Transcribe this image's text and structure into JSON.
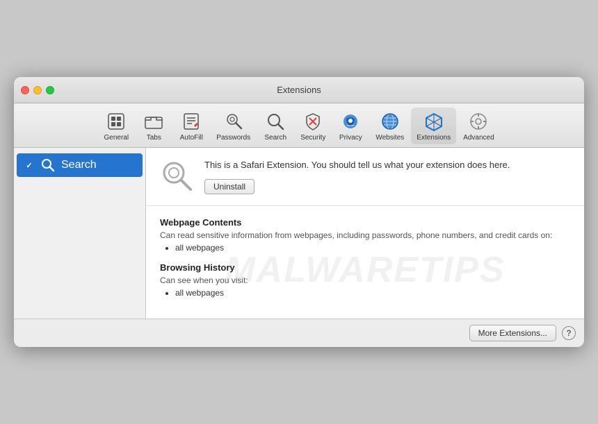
{
  "window": {
    "title": "Extensions"
  },
  "titlebar": {
    "buttons": {
      "close": "close",
      "minimize": "minimize",
      "maximize": "maximize"
    }
  },
  "toolbar": {
    "items": [
      {
        "id": "general",
        "label": "General",
        "icon": "general"
      },
      {
        "id": "tabs",
        "label": "Tabs",
        "icon": "tabs"
      },
      {
        "id": "autofill",
        "label": "AutoFill",
        "icon": "autofill"
      },
      {
        "id": "passwords",
        "label": "Passwords",
        "icon": "passwords"
      },
      {
        "id": "search",
        "label": "Search",
        "icon": "search"
      },
      {
        "id": "security",
        "label": "Security",
        "icon": "security"
      },
      {
        "id": "privacy",
        "label": "Privacy",
        "icon": "privacy"
      },
      {
        "id": "websites",
        "label": "Websites",
        "icon": "websites"
      },
      {
        "id": "extensions",
        "label": "Extensions",
        "icon": "extensions",
        "active": true
      },
      {
        "id": "advanced",
        "label": "Advanced",
        "icon": "advanced"
      }
    ]
  },
  "sidebar": {
    "items": [
      {
        "id": "search-ext",
        "label": "Search",
        "checked": true,
        "selected": true
      }
    ]
  },
  "extension": {
    "description": "This is a Safari Extension. You should tell us what your extension does here.",
    "uninstall_label": "Uninstall"
  },
  "permissions": {
    "sections": [
      {
        "title": "Webpage Contents",
        "description": "Can read sensitive information from webpages, including passwords, phone numbers, and credit cards on:",
        "items": [
          "all webpages"
        ]
      },
      {
        "title": "Browsing History",
        "description": "Can see when you visit:",
        "items": [
          "all webpages"
        ]
      }
    ]
  },
  "footer": {
    "more_extensions_label": "More Extensions...",
    "help_label": "?"
  },
  "watermark": {
    "text": "MALWARETIPS"
  }
}
